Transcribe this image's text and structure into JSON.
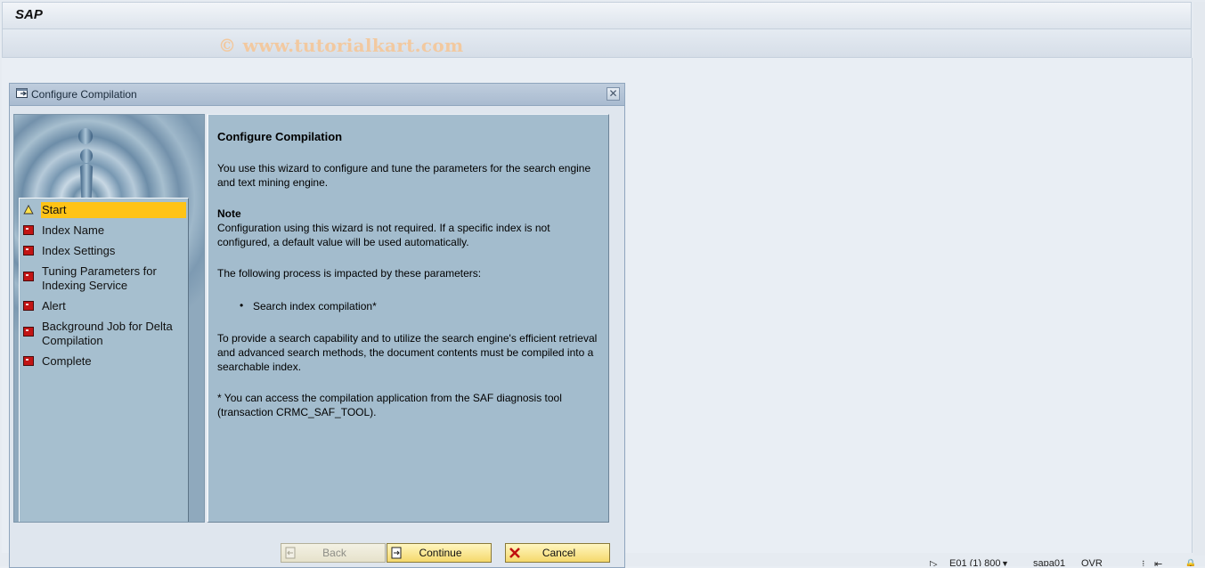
{
  "window": {
    "app_title": "SAP",
    "watermark": "© www.tutorialkart.com"
  },
  "dialog": {
    "title": "Configure Compilation",
    "close_glyph": "✕"
  },
  "steps": [
    {
      "label": "Start",
      "status": "current"
    },
    {
      "label": "Index Name",
      "status": "pending"
    },
    {
      "label": "Index Settings",
      "status": "pending"
    },
    {
      "label": "Tuning Parameters for Indexing Service",
      "status": "pending"
    },
    {
      "label": "Alert",
      "status": "pending"
    },
    {
      "label": "Background Job for Delta Compilation",
      "status": "pending"
    },
    {
      "label": "Complete",
      "status": "pending"
    }
  ],
  "content": {
    "heading": "Configure Compilation",
    "intro": "You use this wizard to configure and tune the parameters for the search engine and text mining engine.",
    "note_heading": "Note",
    "note_text": "Configuration using this wizard is not required. If a specific index is not configured, a default value will be used automatically.",
    "process_intro": "The following process is impacted by these parameters:",
    "bullet": "Search index compilation*",
    "bullet_detail": "To provide a search capability and to utilize the search engine's efficient retrieval and advanced search methods, the document contents must be compiled into a searchable index.",
    "footnote": "* You can access the compilation application from the SAF diagnosis tool (transaction CRMC_SAF_TOOL)."
  },
  "buttons": {
    "back": "Back",
    "continue": "Continue",
    "cancel": "Cancel"
  },
  "status_bar": {
    "system": "E01 (1) 800",
    "server": "sapa01",
    "mode": "OVR"
  },
  "colors": {
    "active_step": "#ffc316",
    "button_face": "#f5d96c",
    "panel_bg": "#a3bccd",
    "status_red": "#c21414"
  }
}
